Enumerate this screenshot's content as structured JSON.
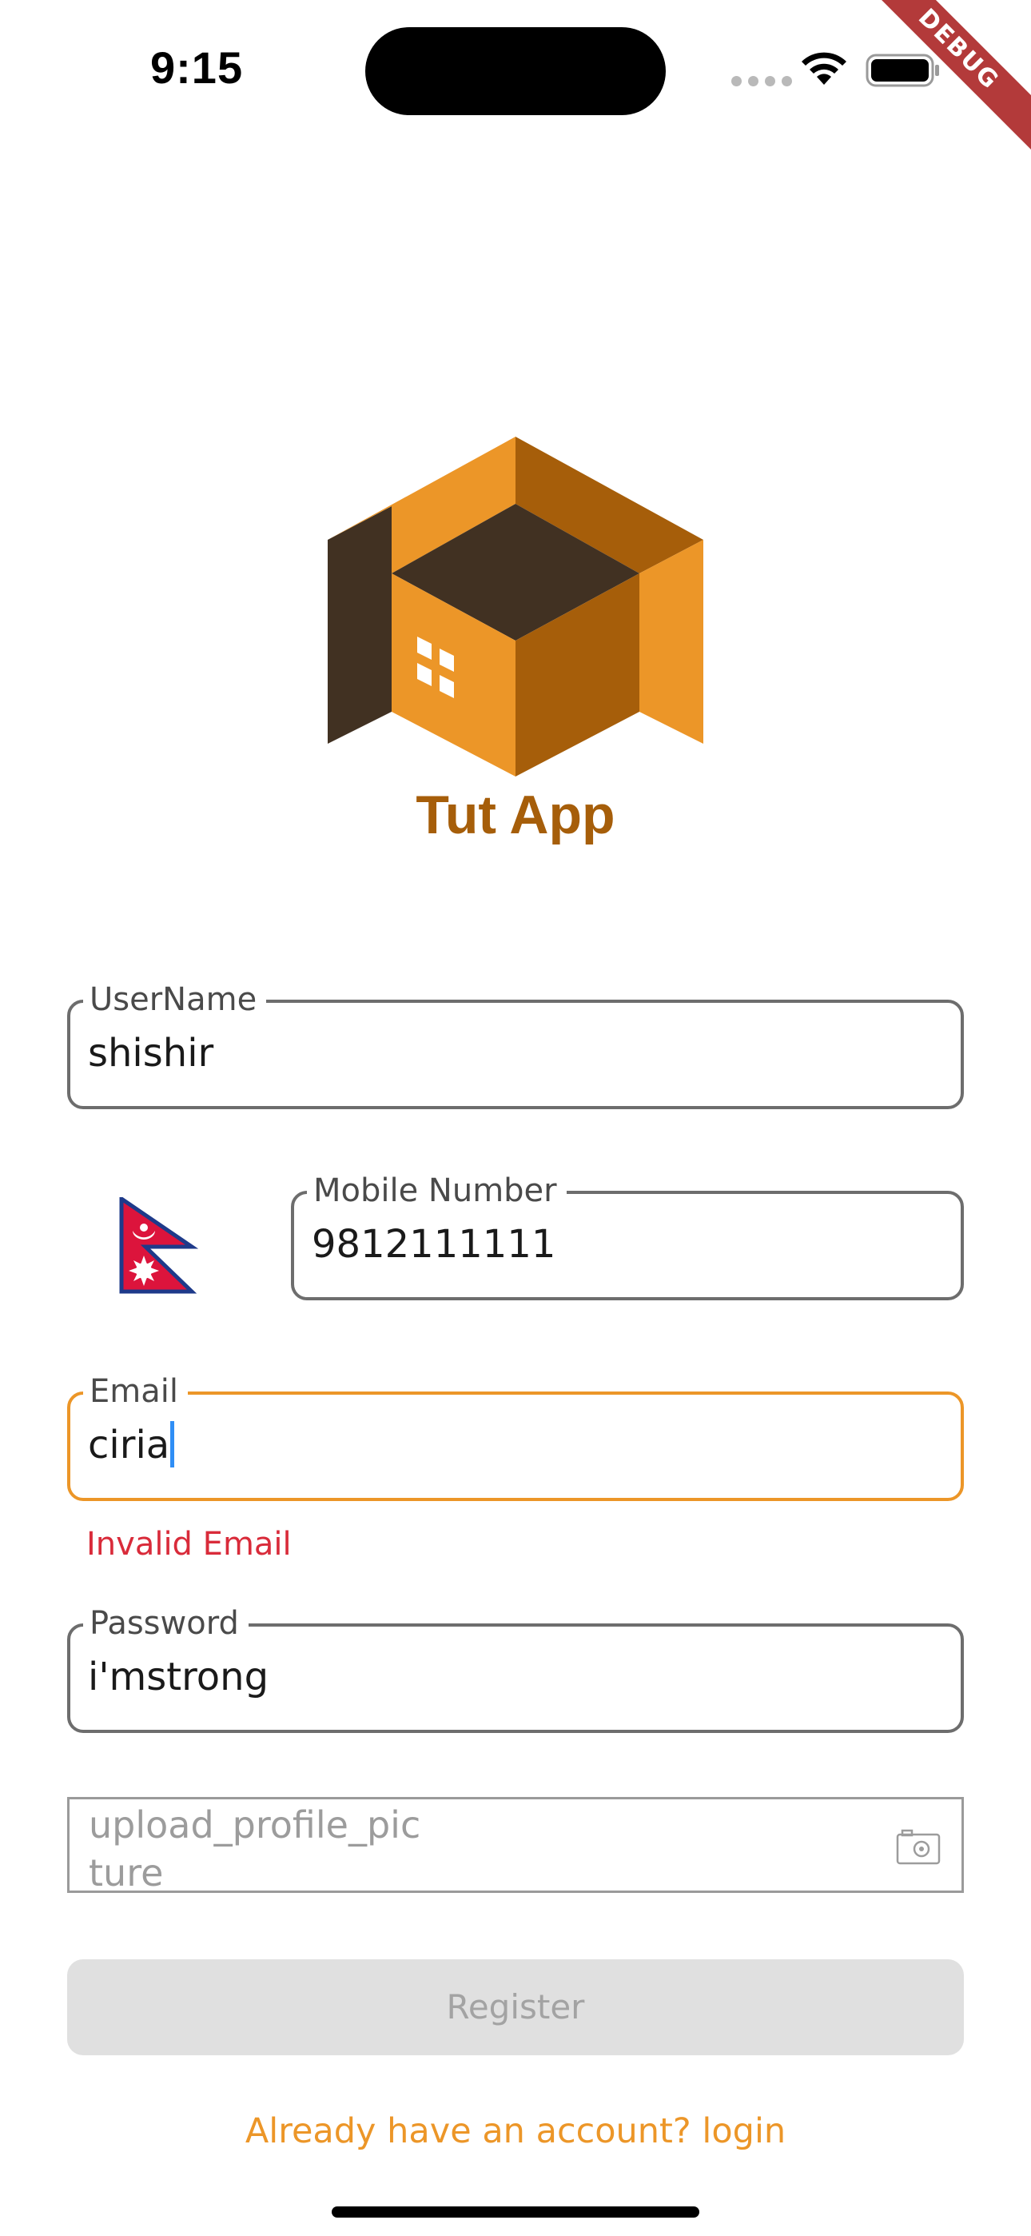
{
  "status_bar": {
    "time": "9:15",
    "debug_banner": "DEBUG"
  },
  "app": {
    "title": "Tut App"
  },
  "form": {
    "username": {
      "label": "UserName",
      "value": "shishir"
    },
    "mobile": {
      "label": "Mobile Number",
      "value": "9812111111",
      "country_flag": "nepal-flag-icon"
    },
    "email": {
      "label": "Email",
      "value": "ciria",
      "error": "Invalid Email"
    },
    "password": {
      "label": "Password",
      "value": "i'mstrong"
    },
    "upload_profile": {
      "label": "upload_profile_picture",
      "icon": "camera-icon"
    },
    "register_label": "Register",
    "login_link": "Already have an account? login"
  },
  "colors": {
    "accent": "#ec9628",
    "brand_dark": "#a65e0a",
    "error": "#d92b3a",
    "disabled_bg": "#e0e0e0"
  }
}
